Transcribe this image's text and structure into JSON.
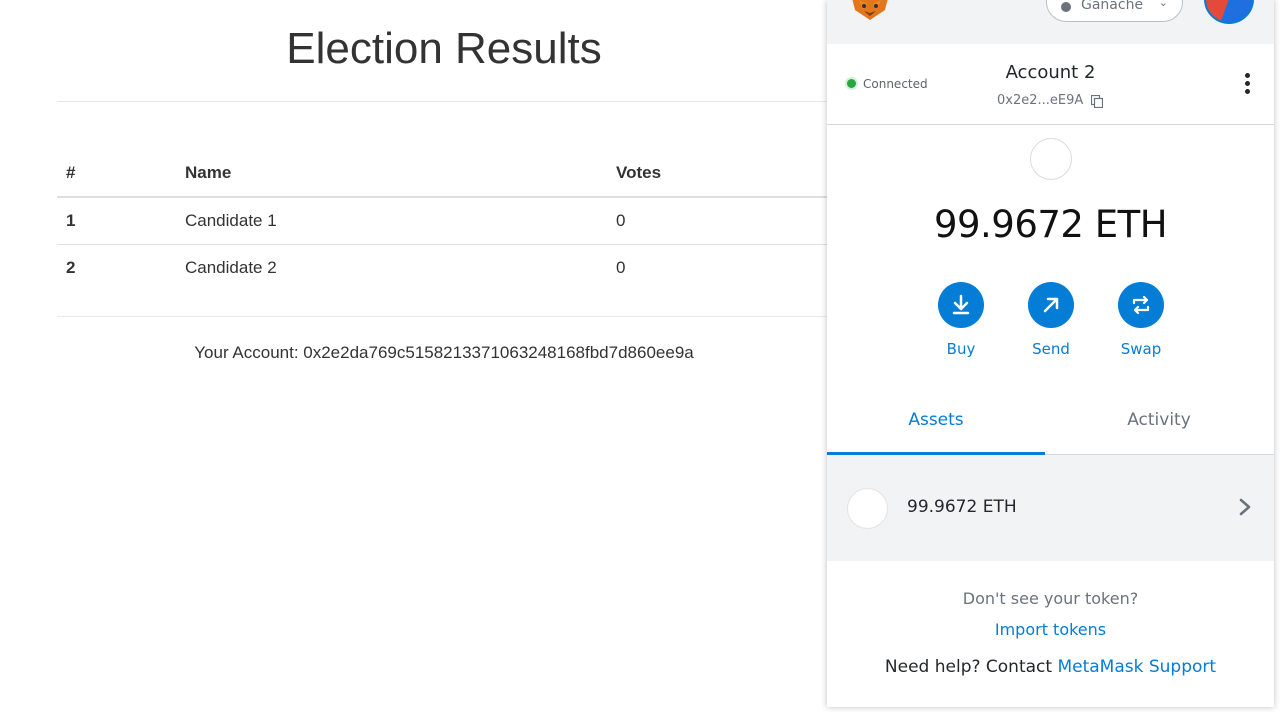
{
  "dapp": {
    "title": "Election Results",
    "table": {
      "headers": [
        "#",
        "Name",
        "Votes"
      ],
      "rows": [
        {
          "id": "1",
          "name": "Candidate 1",
          "votes": "0"
        },
        {
          "id": "2",
          "name": "Candidate 2",
          "votes": "0"
        }
      ]
    },
    "account_line": "Your Account: 0x2e2da769c5158213371063248168fbd7d860ee9a"
  },
  "metamask": {
    "network": "Ganache",
    "status": "Connected",
    "account_name": "Account 2",
    "account_address": "0x2e2...eE9A",
    "balance": "99.9672 ETH",
    "actions": {
      "buy": "Buy",
      "send": "Send",
      "swap": "Swap"
    },
    "tabs": {
      "assets": "Assets",
      "activity": "Activity"
    },
    "asset_amount": "99.9672 ETH",
    "dont_see_token": "Don't see your token?",
    "import_tokens": "Import tokens",
    "help_prefix": "Need help? Contact",
    "help_link": "MetaMask Support",
    "colors": {
      "accent": "#037dd6",
      "connected": "#28a745",
      "surface": "#f2f3f4"
    },
    "icons": [
      "fox-logo-icon",
      "network-dot-icon",
      "chevron-down-icon",
      "copy-icon",
      "kebab-menu-icon",
      "download-icon",
      "send-arrow-icon",
      "swap-icon",
      "chevron-right-icon"
    ]
  }
}
